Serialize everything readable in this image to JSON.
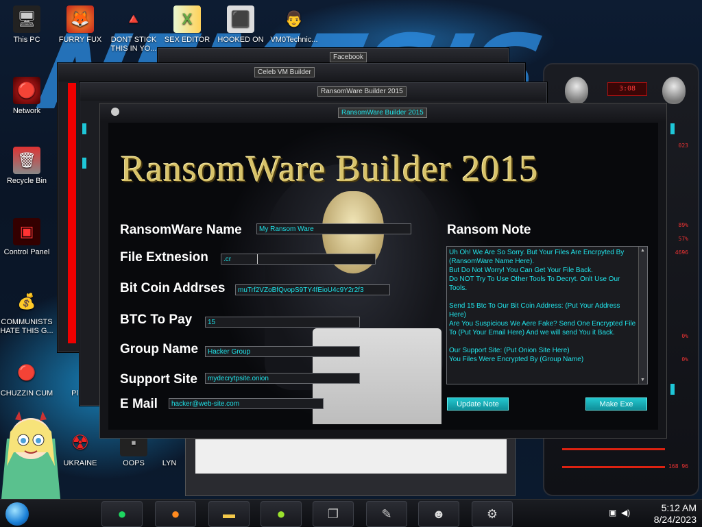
{
  "desktop": {
    "wallpaper_text": "NEMESIS",
    "icons": [
      {
        "label": "This PC",
        "glyph": "🖥"
      },
      {
        "label": "FURRY FUX",
        "glyph": "🦊"
      },
      {
        "label": "DONT STICK THIS IN YO...",
        "glyph": "🔺"
      },
      {
        "label": "SEX EDITOR",
        "glyph": "X"
      },
      {
        "label": "HOOKED ON",
        "glyph": "⬛"
      },
      {
        "label": "VM0Technic...",
        "glyph": "👨"
      },
      {
        "label": "Network",
        "glyph": "🔴"
      },
      {
        "label": "Recycle Bin",
        "glyph": "🗑"
      },
      {
        "label": "Control Panel",
        "glyph": "▣"
      },
      {
        "label": "COMMUNISTS HATE THIS G...",
        "glyph": "💰"
      },
      {
        "label": "CHUZZIN CUM",
        "glyph": "🔴"
      },
      {
        "label": "UKRAINE",
        "glyph": "☢"
      },
      {
        "label": "OOPS",
        "glyph": "▪"
      },
      {
        "label": "Pl Zo",
        "glyph": ""
      },
      {
        "label": "LYN",
        "glyph": ""
      }
    ],
    "right_panel": {
      "readout": "3:08",
      "stats": [
        "023",
        "89%",
        "57%",
        "4696",
        "0%",
        "0%",
        "168 96"
      ]
    }
  },
  "windows": {
    "back_titles": [
      "Facebook",
      "Celeb VM Builder",
      "RansomWare Builder 2015"
    ]
  },
  "app": {
    "window_title": "RansomWare Builder 2015",
    "banner": "RansomWare Builder 2015",
    "fields": {
      "name_label": "RansomWare Name",
      "name_value": "My Ransom Ware",
      "ext_label": "File Extnesion",
      "ext_value": ".cr",
      "btc_label": "Bit Coin Addrses",
      "btc_value": "muTrf2VZoBfQvopS9TY4fEioU4c9Y2r2f3",
      "pay_label": "BTC To Pay",
      "pay_value": "15",
      "group_label": "Group Name",
      "group_value": "Hacker Group",
      "site_label": "Support Site",
      "site_value": "mydecrytpsite.onion",
      "email_label": "E Mail",
      "email_value": "hacker@web-site.com"
    },
    "note_label": "Ransom Note",
    "note_text": "Uh Oh! We Are So Sorry. But Your Files Are Encrpyted By (RansomWare Name Here).\nBut Do Not Worry! You Can Get Your File Back.\nDo NOT Try To Use Other Tools To Decryt. Onlt Use Our Tools.\n\nSend 15 Btc To Our Bit Coin Address: (Put Your Address Here)\nAre You Suspicious We Aere Fake? Send One Encrypted File To (Put Your Email Here) And we will send You it Back.\n\nOur Support Site: (Put Onion Site Here)\nYou Files Were Encrypted By (Group Name)",
    "update_btn": "Update Note",
    "make_btn": "Make Exe"
  },
  "taskbar": {
    "time": "5:12 AM",
    "date": "8/24/2023",
    "apps": [
      "spotify-icon",
      "firefox-icon",
      "explorer-icon",
      "lime-icon",
      "windows-icon",
      "tool-icon",
      "alien-icon",
      "settings-icon"
    ]
  }
}
